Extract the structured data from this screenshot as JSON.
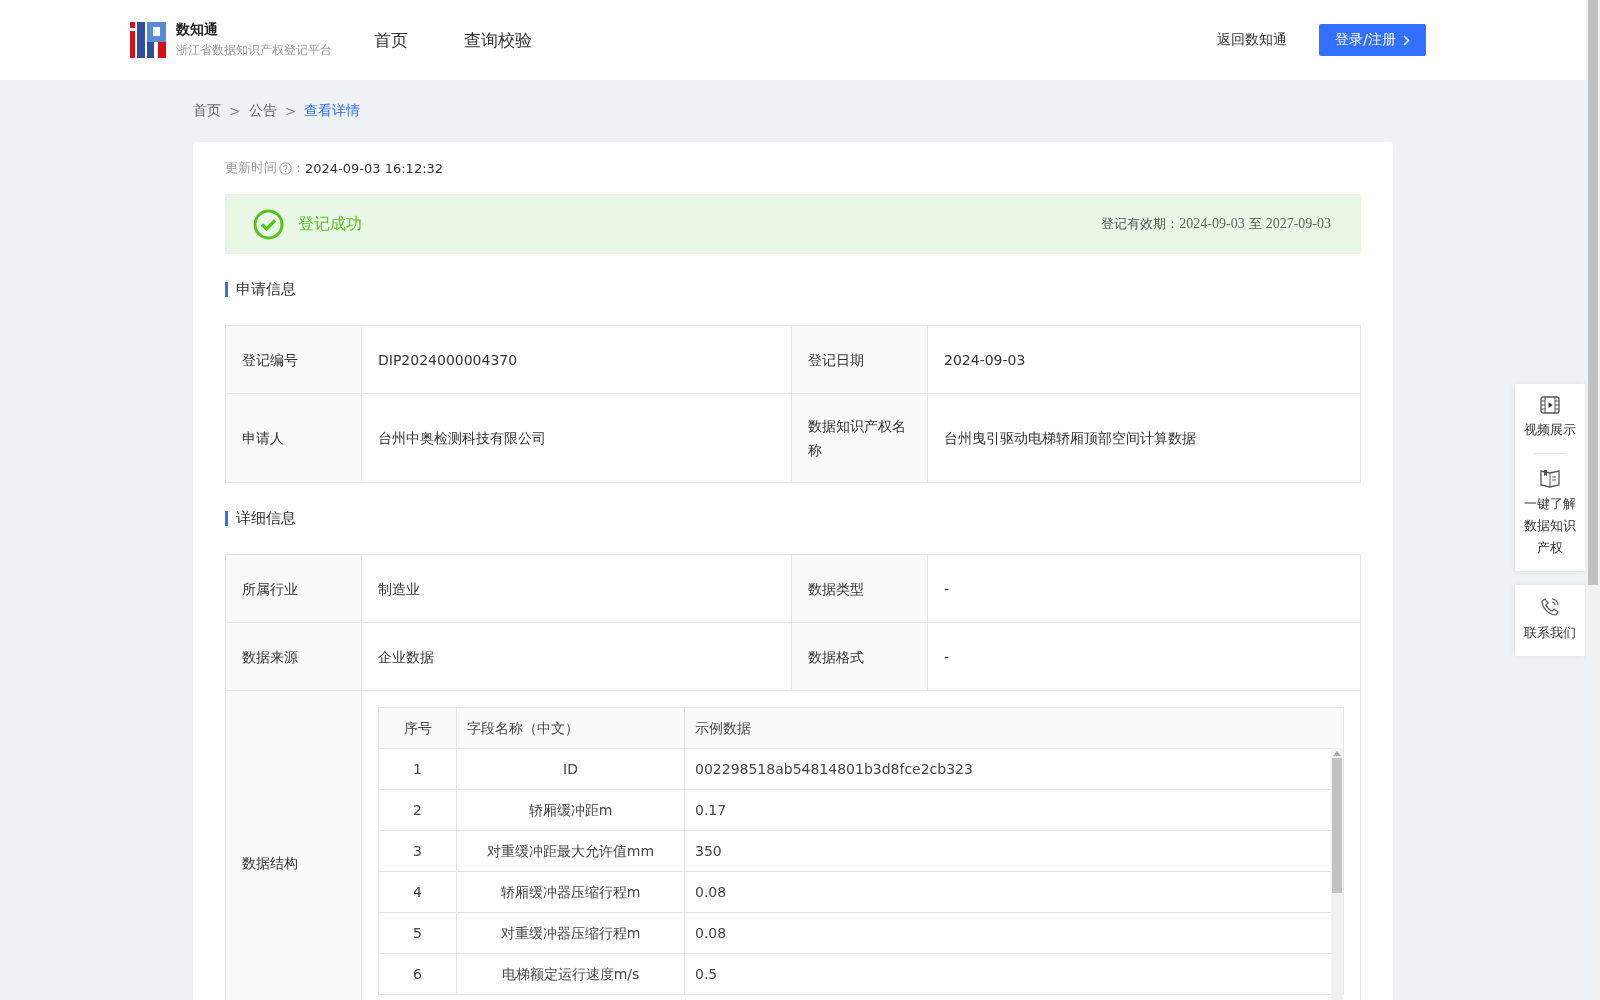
{
  "header": {
    "brand": "数知通",
    "subtitle": "浙江省数据知识产权登记平台",
    "nav": [
      {
        "label": "首页",
        "selected": false
      },
      {
        "label": "查询校验",
        "selected": false
      }
    ],
    "back_link": "返回数知通",
    "login_button": "登录/注册"
  },
  "breadcrumb": [
    {
      "label": "首页"
    },
    {
      "label": "公告"
    },
    {
      "label": "查看详情"
    }
  ],
  "breadcrumb_separator": ">",
  "update_time": {
    "label": "更新时间",
    "separator": "：",
    "value": "2024-09-03 16:12:32"
  },
  "status": {
    "kind": "success",
    "text": "登记成功",
    "validity_label": "登记有效期：",
    "validity_start": "2024-09-03",
    "validity_to": "至",
    "validity_end": "2027-09-03"
  },
  "sections": [
    {
      "title": "申请信息",
      "rows": [
        [
          {
            "label": "登记编号",
            "value": "DIP2024000004370"
          },
          {
            "label": "登记日期",
            "value": "2024-09-03"
          }
        ],
        [
          {
            "label": "申请人",
            "value": "台州中奥检测科技有限公司"
          },
          {
            "label": "数据知识产权名称",
            "value": "台州曳引驱动电梯轿厢顶部空间计算数据"
          }
        ]
      ]
    },
    {
      "title": "详细信息",
      "rows": [
        [
          {
            "label": "所属行业",
            "value": "制造业"
          },
          {
            "label": "数据类型",
            "value": "-"
          }
        ],
        [
          {
            "label": "数据来源",
            "value": "企业数据"
          },
          {
            "label": "数据格式",
            "value": "-"
          }
        ]
      ],
      "structure": {
        "label": "数据结构",
        "columns": [
          "序号",
          "字段名称（中文）",
          "示例数据"
        ],
        "rows": [
          [
            "1",
            "ID",
            "002298518ab54814801b3d8fce2cb323"
          ],
          [
            "2",
            "轿厢缓冲距m",
            "0.17"
          ],
          [
            "3",
            "对重缓冲距最大允许值mm",
            "350"
          ],
          [
            "4",
            "轿厢缓冲器压缩行程m",
            "0.08"
          ],
          [
            "5",
            "对重缓冲器压缩行程m",
            "0.08"
          ],
          [
            "6",
            "电梯额定运行速度m/s",
            "0.5"
          ]
        ]
      }
    }
  ],
  "side_panel": [
    {
      "kind": "video",
      "label": "视频展示"
    },
    {
      "kind": "book",
      "label": "一键了解数据知识产权"
    },
    {
      "kind": "phone",
      "label": "联系我们"
    }
  ]
}
